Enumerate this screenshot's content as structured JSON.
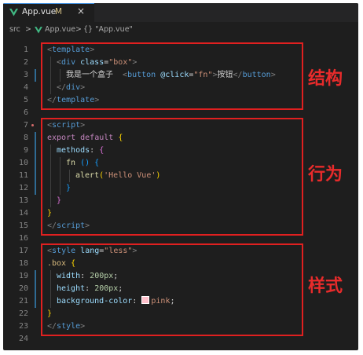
{
  "tab": {
    "filename": "App.vue",
    "modified": "M",
    "close": "×"
  },
  "breadcrumb": {
    "folder": "src",
    "sep1": ">",
    "file": "App.vue",
    "sep2": ">",
    "symbol": "{} \"App.vue\""
  },
  "line_numbers": [
    "1",
    "2",
    "3",
    "4",
    "5",
    "6",
    "7",
    "8",
    "9",
    "10",
    "11",
    "12",
    "13",
    "14",
    "15",
    "16",
    "17",
    "18",
    "19",
    "20",
    "21",
    "22",
    "23",
    "24"
  ],
  "code": {
    "l1": {
      "open": "<",
      "tag": "template",
      "close": ">"
    },
    "l2": {
      "open": "<",
      "tag": "div",
      "attr": "class",
      "eq": "=",
      "val": "\"box\"",
      "close": ">"
    },
    "l3": {
      "text": "我是一个盒子",
      "open": "<",
      "tag": "button",
      "attr": "@click",
      "eq": "=",
      "val": "\"fn\"",
      "mid": ">",
      "label": "按钮",
      "endopen": "</",
      "endtag": "button",
      "close": ">"
    },
    "l4": {
      "open": "</",
      "tag": "div",
      "close": ">"
    },
    "l5": {
      "open": "</",
      "tag": "template",
      "close": ">"
    },
    "l7": {
      "open": "<",
      "tag": "script",
      "close": ">"
    },
    "l8": {
      "kw": "export default",
      "brace": "{"
    },
    "l9": {
      "prop": "methods",
      "colon": ":",
      "brace": "{"
    },
    "l10": {
      "fn": "fn",
      "parens": "()",
      "brace": "{"
    },
    "l11": {
      "fn": "alert",
      "popen": "(",
      "str": "'Hello Vue'",
      "pclose": ")"
    },
    "l12": {
      "brace": "}"
    },
    "l13": {
      "brace": "}"
    },
    "l14": {
      "brace": "}"
    },
    "l15": {
      "open": "</",
      "tag": "script",
      "close": ">"
    },
    "l17": {
      "open": "<",
      "tag": "style",
      "attr": "lang",
      "eq": "=",
      "val": "\"less\"",
      "close": ">"
    },
    "l18": {
      "selector": ".box",
      "brace": "{"
    },
    "l19": {
      "prop": "width",
      "colon": ":",
      "num": "200px",
      "semi": ";"
    },
    "l20": {
      "prop": "height",
      "colon": ":",
      "num": "200px",
      "semi": ";"
    },
    "l21": {
      "prop": "background-color",
      "colon": ":",
      "val": "pink",
      "semi": ";"
    },
    "l22": {
      "brace": "}"
    },
    "l23": {
      "open": "</",
      "tag": "style",
      "close": ">"
    }
  },
  "annotations": {
    "structure": "结构",
    "behavior": "行为",
    "style": "样式"
  },
  "colors": {
    "annotation_red": "#e02020",
    "swatch": "#ffc0cb"
  }
}
